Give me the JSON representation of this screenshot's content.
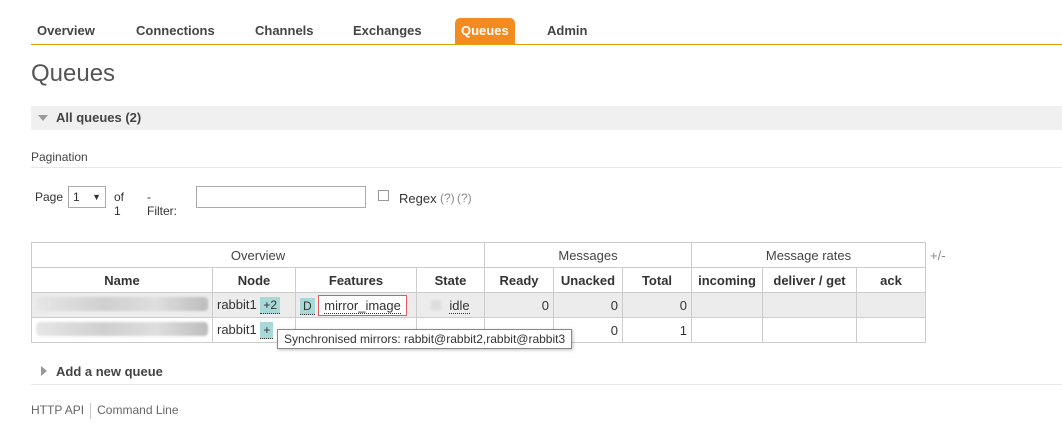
{
  "nav": {
    "items": [
      "Overview",
      "Connections",
      "Channels",
      "Exchanges",
      "Queues",
      "Admin"
    ],
    "active": "Queues"
  },
  "page_title": "Queues",
  "section": {
    "label": "All queues (2)"
  },
  "pagination": {
    "heading": "Pagination",
    "page_label": "Page",
    "page_value": "1",
    "of_label": "of 1",
    "filter_label": "- Filter:",
    "filter_value": "",
    "regex_label": "Regex",
    "help1": "(?)",
    "help2": "(?)"
  },
  "table": {
    "group_headers": [
      "Overview",
      "Messages",
      "Message rates"
    ],
    "columns": [
      "Name",
      "Node",
      "Features",
      "State",
      "Ready",
      "Unacked",
      "Total",
      "incoming",
      "deliver / get",
      "ack"
    ],
    "plus_minus": "+/-",
    "rows": [
      {
        "node": "rabbit1",
        "mirrors": "+2",
        "feature_flag": "D",
        "policy": "mirror_image",
        "state": "idle",
        "ready": "0",
        "unacked": "0",
        "total": "0"
      },
      {
        "node": "rabbit1",
        "mirrors": "+",
        "feature_flag": "",
        "policy": "",
        "state": "",
        "ready": "",
        "unacked": "0",
        "total": "1"
      }
    ]
  },
  "tooltip": "Synchronised mirrors: rabbit@rabbit2,rabbit@rabbit3",
  "add_queue": {
    "label": "Add a new queue"
  },
  "footer": {
    "http_api": "HTTP API",
    "command_line": "Command Line"
  },
  "colors": {
    "accent": "#f48b21",
    "feature_tag": "#a8d8d8",
    "highlight_border": "#e05a5a"
  }
}
